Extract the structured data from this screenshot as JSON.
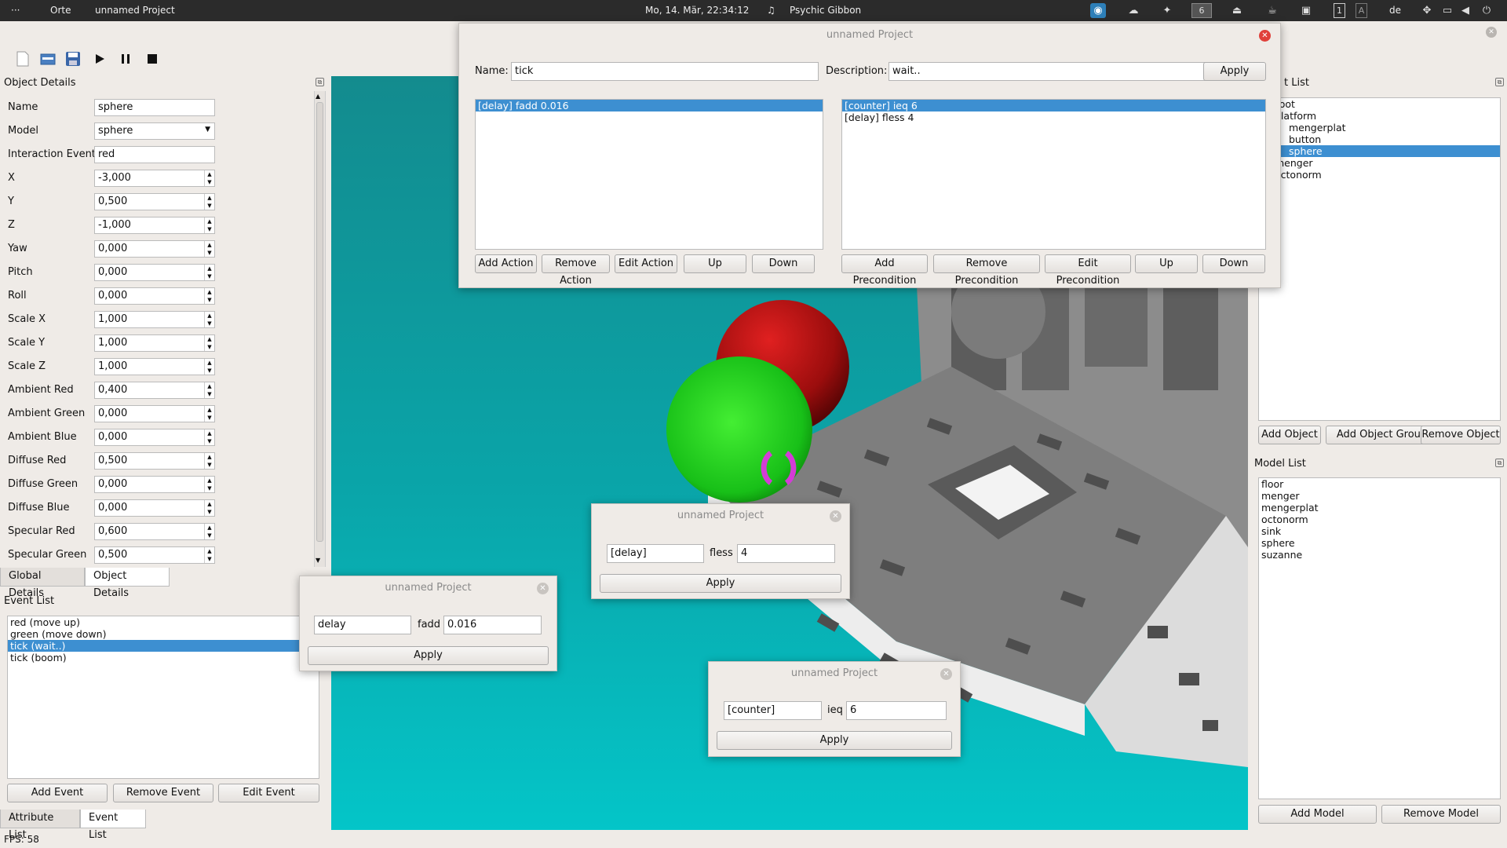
{
  "topbar": {
    "dots": "···",
    "places": "Orte",
    "app_title": "unnamed Project",
    "clock": "Mo, 14. Mär, 22:34:12",
    "music": "Psychic Gibbon",
    "workspace": "6",
    "lang": "de",
    "num1": "1",
    "numA": "A"
  },
  "toolbar": {
    "icons": [
      "new-file-icon",
      "open-folder-icon",
      "save-icon",
      "play-icon",
      "pause-icon",
      "stop-icon"
    ]
  },
  "object_details": {
    "title": "Object Details",
    "fields": [
      {
        "label": "Name",
        "value": "sphere",
        "type": "text"
      },
      {
        "label": "Model",
        "value": "sphere",
        "type": "combo"
      },
      {
        "label": "Interaction Event",
        "value": "red",
        "type": "text"
      },
      {
        "label": "X",
        "value": "-3,000",
        "type": "spin"
      },
      {
        "label": "Y",
        "value": "0,500",
        "type": "spin"
      },
      {
        "label": "Z",
        "value": "-1,000",
        "type": "spin"
      },
      {
        "label": "Yaw",
        "value": "0,000",
        "type": "spin"
      },
      {
        "label": "Pitch",
        "value": "0,000",
        "type": "spin"
      },
      {
        "label": "Roll",
        "value": "0,000",
        "type": "spin"
      },
      {
        "label": "Scale X",
        "value": "1,000",
        "type": "spin"
      },
      {
        "label": "Scale Y",
        "value": "1,000",
        "type": "spin"
      },
      {
        "label": "Scale Z",
        "value": "1,000",
        "type": "spin"
      },
      {
        "label": "Ambient Red",
        "value": "0,400",
        "type": "spin"
      },
      {
        "label": "Ambient Green",
        "value": "0,000",
        "type": "spin"
      },
      {
        "label": "Ambient Blue",
        "value": "0,000",
        "type": "spin"
      },
      {
        "label": "Diffuse Red",
        "value": "0,500",
        "type": "spin"
      },
      {
        "label": "Diffuse Green",
        "value": "0,000",
        "type": "spin"
      },
      {
        "label": "Diffuse Blue",
        "value": "0,000",
        "type": "spin"
      },
      {
        "label": "Specular Red",
        "value": "0,600",
        "type": "spin"
      },
      {
        "label": "Specular Green",
        "value": "0,500",
        "type": "spin"
      }
    ],
    "tabs": [
      "Global Details",
      "Object Details"
    ]
  },
  "event_list": {
    "title": "Event List",
    "items": [
      "red (move up)",
      "green (move down)",
      "tick (wait..)",
      "tick (boom)"
    ],
    "selected": 2,
    "buttons": [
      "Add Event",
      "Remove Event",
      "Edit Event"
    ],
    "tabs": [
      "Attribute List",
      "Event List"
    ]
  },
  "status": {
    "fps": "FPS: 58"
  },
  "object_list": {
    "title": "t List",
    "items": [
      {
        "label": "neRoot",
        "indent": 0
      },
      {
        "label": "platform",
        "indent": 1
      },
      {
        "label": "mengerplat",
        "indent": 2
      },
      {
        "label": "button",
        "indent": 2
      },
      {
        "label": "sphere",
        "indent": 2,
        "selected": true
      },
      {
        "label": "menger",
        "indent": 1
      },
      {
        "label": "octonorm",
        "indent": 1
      }
    ],
    "buttons": [
      "Add Object",
      "Add Object Group",
      "Remove Object"
    ]
  },
  "model_list": {
    "title": "Model List",
    "items": [
      "floor",
      "menger",
      "mengerplat",
      "octonorm",
      "sink",
      "sphere",
      "suzanne"
    ],
    "buttons": [
      "Add Model",
      "Remove Model"
    ]
  },
  "event_dialog": {
    "title": "unnamed Project",
    "name_label": "Name:",
    "name_value": "tick",
    "desc_label": "Description:",
    "desc_value": "wait..",
    "apply": "Apply",
    "actions": [
      "[delay] fadd 0.016"
    ],
    "preconditions": [
      "[counter] ieq 6",
      "[delay] fless 4"
    ],
    "action_buttons": [
      "Add Action",
      "Remove Action",
      "Edit Action",
      "Up",
      "Down"
    ],
    "precondition_buttons": [
      "Add Precondition",
      "Remove Precondition",
      "Edit Precondition",
      "Up",
      "Down"
    ]
  },
  "dialog_fless": {
    "title": "unnamed Project",
    "var": "[delay]",
    "op": "fless",
    "val": "4",
    "apply": "Apply"
  },
  "dialog_fadd": {
    "title": "unnamed Project",
    "var": "delay",
    "op": "fadd",
    "val": "0.016",
    "apply": "Apply"
  },
  "dialog_ieq": {
    "title": "unnamed Project",
    "var": "[counter]",
    "op": "ieq",
    "val": "6",
    "apply": "Apply"
  },
  "colors": {
    "accent": "#3d8fd1",
    "viewport_top": "#138b8e",
    "viewport_bottom": "#04c5c8",
    "close_red": "#e0403a"
  }
}
